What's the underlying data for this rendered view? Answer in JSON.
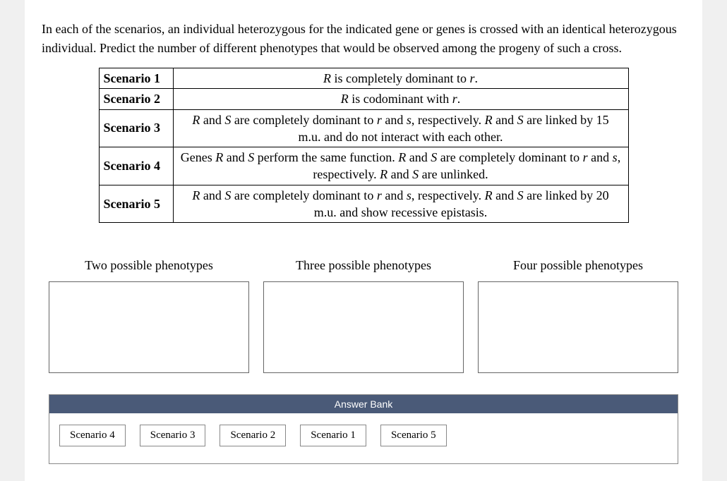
{
  "question": "In each of the scenarios, an individual heterozygous for the indicated gene or genes is crossed with an identical heterozygous individual. Predict the number of different phenotypes that would be observed among the progeny of such a cross.",
  "scenarios": {
    "row1": {
      "label": "Scenario 1",
      "desc_html": "<span class='italic'>R</span> is completely dominant to <span class='italic'>r</span>."
    },
    "row2": {
      "label": "Scenario 2",
      "desc_html": "<span class='italic'>R</span> is codominant with <span class='italic'>r</span>."
    },
    "row3": {
      "label": "Scenario 3",
      "desc_html": "<span class='italic'>R</span> and <span class='italic'>S</span> are completely dominant to <span class='italic'>r</span> and <span class='italic'>s</span>, respectively. <span class='italic'>R</span> and <span class='italic'>S</span> are linked by 15 m.u. and do not interact with each other."
    },
    "row4": {
      "label": "Scenario 4",
      "desc_html": "Genes <span class='italic'>R</span> and <span class='italic'>S</span> perform the same function. <span class='italic'>R</span> and <span class='italic'>S</span> are completely dominant to <span class='italic'>r</span> and <span class='italic'>s</span>, respectively. <span class='italic'>R</span> and <span class='italic'>S</span> are unlinked."
    },
    "row5": {
      "label": "Scenario 5",
      "desc_html": "<span class='italic'>R</span> and <span class='italic'>S</span> are completely dominant to <span class='italic'>r</span> and <span class='italic'>s</span>, respectively. <span class='italic'>R</span> and <span class='italic'>S</span> are linked by 20 m.u. and show recessive epistasis."
    }
  },
  "drop_zones": {
    "zone1_title": "Two possible phenotypes",
    "zone2_title": "Three possible phenotypes",
    "zone3_title": "Four possible phenotypes"
  },
  "answer_bank": {
    "header": "Answer Bank",
    "chips": [
      "Scenario 4",
      "Scenario 3",
      "Scenario 2",
      "Scenario 1",
      "Scenario 5"
    ]
  }
}
